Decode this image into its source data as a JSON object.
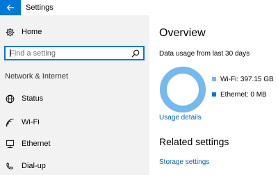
{
  "window": {
    "title": "Settings"
  },
  "sidebar": {
    "home_label": "Home",
    "search_placeholder": "Find a setting",
    "section_title": "Network & Internet",
    "items": [
      {
        "label": "Status",
        "icon": "globe-icon"
      },
      {
        "label": "Wi-Fi",
        "icon": "wifi-icon"
      },
      {
        "label": "Ethernet",
        "icon": "ethernet-icon"
      },
      {
        "label": "Dial-up",
        "icon": "dialup-icon"
      }
    ]
  },
  "main": {
    "overview_title": "Overview",
    "usage_subtitle": "Data usage from last 30 days",
    "usage": {
      "wifi_label": "Wi-Fi: 397.15 GB",
      "ethernet_label": "Ethernet: 0 MB",
      "wifi_fraction": 1.0,
      "ethernet_fraction": 0.0,
      "wifi_color": "#76b9ed",
      "ethernet_color": "#0078d7"
    },
    "usage_details_link": "Usage details",
    "related_title": "Related settings",
    "storage_link": "Storage settings"
  },
  "colors": {
    "accent": "#0078d7",
    "sidebar_bg": "#f2f2f2",
    "link": "#0063b1"
  }
}
